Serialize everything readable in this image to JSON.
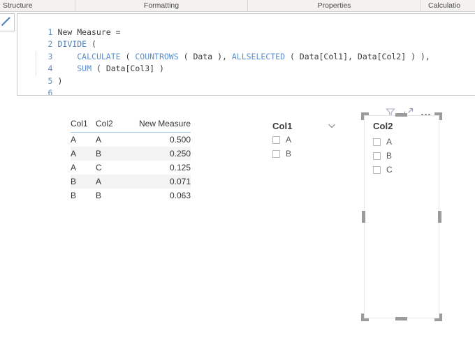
{
  "ribbon": {
    "groups": [
      {
        "label": "Structure"
      },
      {
        "label": "Formatting"
      },
      {
        "label": "Properties"
      },
      {
        "label": "Calculatio"
      }
    ]
  },
  "formula_bar": {
    "commit_icon": "checkmark-icon",
    "lines": [
      {
        "number": "1",
        "text": "New Measure ="
      },
      {
        "number": "2",
        "text": "DIVIDE ("
      },
      {
        "number": "3",
        "text": "    CALCULATE ( COUNTROWS ( Data ), ALLSELECTED ( Data[Col1], Data[Col2] ) ),"
      },
      {
        "number": "4",
        "text": "    SUM ( Data[Col3] )"
      },
      {
        "number": "5",
        "text": ")"
      },
      {
        "number": "6",
        "text": ""
      }
    ],
    "tokens": {
      "l1_name": "New Measure",
      "l1_eq": "=",
      "l2_fn": "DIVIDE",
      "l3_fn1": "CALCULATE",
      "l3_fn2": "COUNTROWS",
      "l3_fn3": "ALLSELECTED",
      "l3_table1": "Data",
      "l3_ref1": "Data[Col1]",
      "l3_ref2": "Data[Col2]",
      "l4_fn": "SUM",
      "l4_ref": "Data[Col3]"
    }
  },
  "table_visual": {
    "columns": [
      {
        "label": "Col1",
        "align": "left"
      },
      {
        "label": "Col2",
        "align": "left"
      },
      {
        "label": "New Measure",
        "align": "right"
      }
    ],
    "rows": [
      {
        "col1": "A",
        "col2": "A",
        "measure": "0.500"
      },
      {
        "col1": "A",
        "col2": "B",
        "measure": "0.250"
      },
      {
        "col1": "A",
        "col2": "C",
        "measure": "0.125"
      },
      {
        "col1": "B",
        "col2": "A",
        "measure": "0.071"
      },
      {
        "col1": "B",
        "col2": "B",
        "measure": "0.063"
      }
    ]
  },
  "slicer_col1": {
    "title": "Col1",
    "expand_icon": "chevron-down-icon",
    "items": [
      {
        "label": "A",
        "checked": false
      },
      {
        "label": "B",
        "checked": false
      }
    ]
  },
  "slicer_col2": {
    "title": "Col2",
    "selected": true,
    "items": [
      {
        "label": "A",
        "checked": false
      },
      {
        "label": "B",
        "checked": false
      },
      {
        "label": "C",
        "checked": false
      }
    ],
    "header_icons": [
      {
        "name": "filter-icon"
      },
      {
        "name": "focus-mode-icon"
      },
      {
        "name": "more-options-icon"
      }
    ]
  },
  "colors": {
    "ribbon_bg": "#f3f2f1",
    "keyword_blue": "#4a7ebb",
    "function_blue": "#5b8fd0",
    "line_number": "#6a8fbf",
    "table_header_rule": "#a5c8e8",
    "row_band": "#f3f3f3",
    "handle_gray": "#9b9b9b",
    "text": "#3b3b3b"
  }
}
